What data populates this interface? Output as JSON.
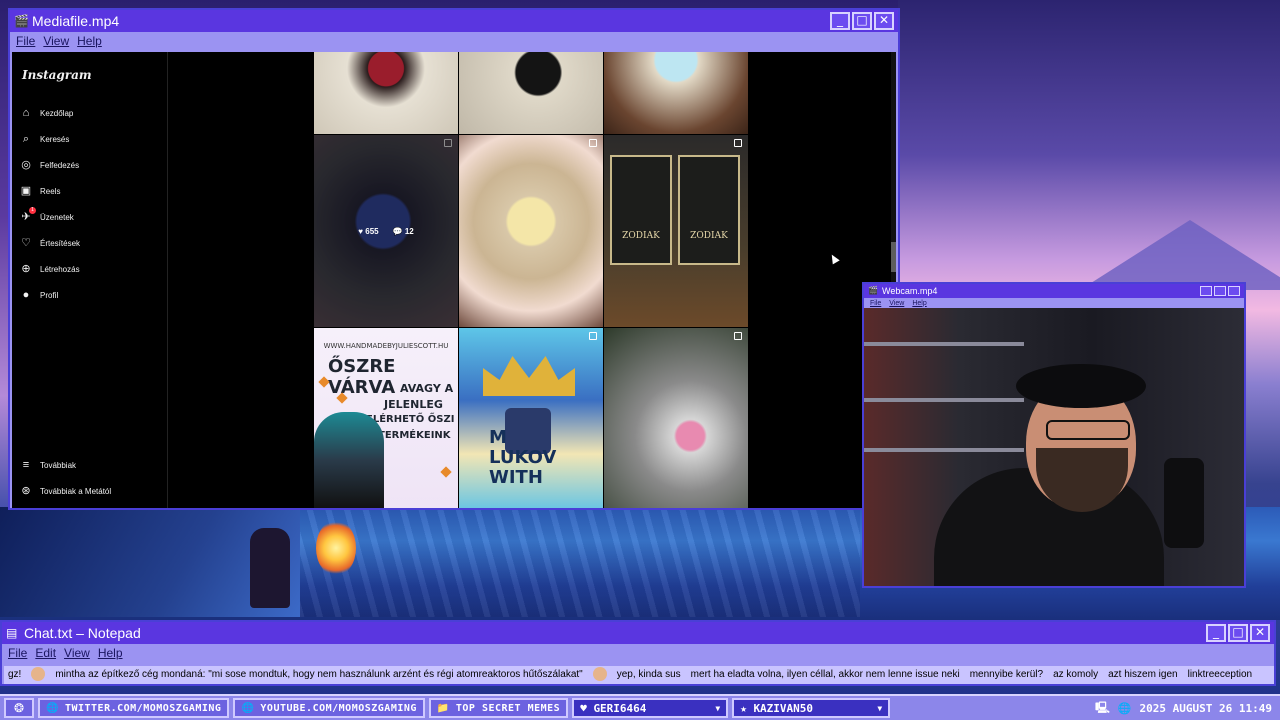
{
  "media_window": {
    "title": "Mediafile.mp4",
    "menu": [
      "File",
      "View",
      "Help"
    ],
    "buttons": {
      "minimize": "_",
      "maximize": "□",
      "close": "✕"
    }
  },
  "instagram": {
    "logo": "Instagram",
    "nav": [
      {
        "label": "Kezdőlap",
        "icon": "home-icon",
        "glyph": "⌂"
      },
      {
        "label": "Keresés",
        "icon": "search-icon",
        "glyph": "⌕"
      },
      {
        "label": "Felfedezés",
        "icon": "compass-icon",
        "glyph": "◎"
      },
      {
        "label": "Reels",
        "icon": "reels-icon",
        "glyph": "▣"
      },
      {
        "label": "Üzenetek",
        "icon": "messages-icon",
        "glyph": "✈",
        "badge": "1"
      },
      {
        "label": "Értesítések",
        "icon": "heart-icon",
        "glyph": "♡"
      },
      {
        "label": "Létrehozás",
        "icon": "create-icon",
        "glyph": "⊕"
      },
      {
        "label": "Profil",
        "icon": "profile-icon",
        "glyph": "●"
      }
    ],
    "bottom_nav": [
      {
        "label": "Továbbiak",
        "icon": "menu-icon",
        "glyph": "≡"
      },
      {
        "label": "Továbbiak a Metától",
        "icon": "meta-icon",
        "glyph": "⊛"
      }
    ],
    "hover_post": {
      "likes": "655",
      "comments": "12"
    },
    "post7": {
      "url": "WWW.HANDMADEBYJULIESCOTT.HU",
      "headline": "ŐSZRE VÁRVA",
      "lines": [
        "AVAGY A",
        "JELENLEG",
        "ELÉRHETŐ ŐSZI",
        "TERMÉKEINK"
      ]
    },
    "post6_labels": [
      "ZODIAK",
      "ZODIAK"
    ],
    "post8_text": [
      "M",
      "LUKOV",
      "WITH"
    ]
  },
  "webcam_window": {
    "title": "Webcam.mp4",
    "menu": [
      "File",
      "View",
      "Help"
    ]
  },
  "notepad": {
    "title": "Chat.txt – Notepad",
    "menu": [
      "File",
      "Edit",
      "View",
      "Help"
    ],
    "messages": [
      "gz!",
      "mintha az építkező cég mondaná: \"mi sose mondtuk, hogy nem használunk arzént és régi atomreaktoros hűtőszálakat\"",
      "yep, kinda sus",
      "mert ha eladta volna, ilyen céllal, akkor nem lenne issue neki",
      "mennyibe kerül?",
      "az komoly",
      "azt hiszem igen",
      "linktreeception"
    ]
  },
  "taskbar": {
    "start_glyph": "❂",
    "items": [
      {
        "label": "TWITTER.COM/MOMOSZGAMING",
        "icon": "globe-icon"
      },
      {
        "label": "YOUTUBE.COM/MOMOSZGAMING",
        "icon": "globe-icon"
      },
      {
        "label": "TOP SECRET MEMES",
        "icon": "folder-icon"
      }
    ],
    "selectors": [
      {
        "label": "GERI6464",
        "icon": "heart-icon",
        "glyph": "♥"
      },
      {
        "label": "KAZIVAN50",
        "icon": "star-icon",
        "glyph": "★"
      }
    ],
    "clock": "2025 AUGUST 26 11:49"
  },
  "colors": {
    "titlebar": "#5a36e0",
    "window_frame": "#9b93f2",
    "taskbar": "#8c86ea"
  }
}
